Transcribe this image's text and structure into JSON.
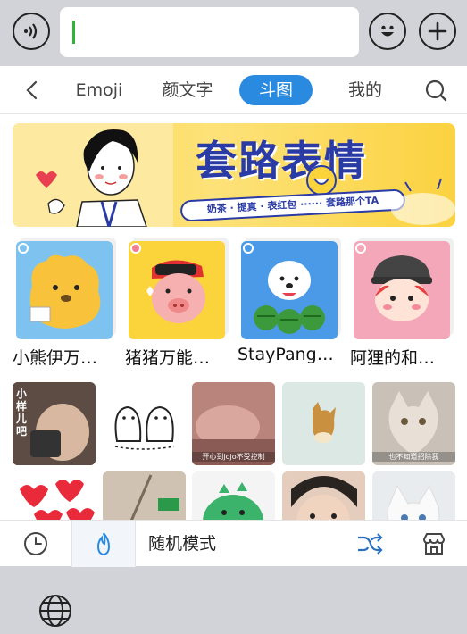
{
  "input": {
    "value": ""
  },
  "tabs": [
    {
      "label": "Emoji"
    },
    {
      "label": "颜文字"
    },
    {
      "label": "斗图"
    },
    {
      "label": "我的"
    }
  ],
  "banner": {
    "title": "套路表情",
    "subtitle": "奶茶 · 提真 · 表红包 ······ 套路那个TA"
  },
  "packs": [
    {
      "label": "小熊伊万…"
    },
    {
      "label": "猪猪万能…"
    },
    {
      "label": "StayPang…"
    },
    {
      "label": "阿狸的和…"
    }
  ],
  "gifs": [
    {
      "caption": "小样儿吧"
    },
    {
      "caption": ""
    },
    {
      "caption": "开心到jojo不受控制"
    },
    {
      "caption": ""
    },
    {
      "caption": "也不知道招除我"
    }
  ],
  "bottom": {
    "mode_label": "随机模式"
  },
  "colors": {
    "accent": "#2a8ae0",
    "caret": "#2fb33a",
    "banner": "#fbd43c"
  }
}
